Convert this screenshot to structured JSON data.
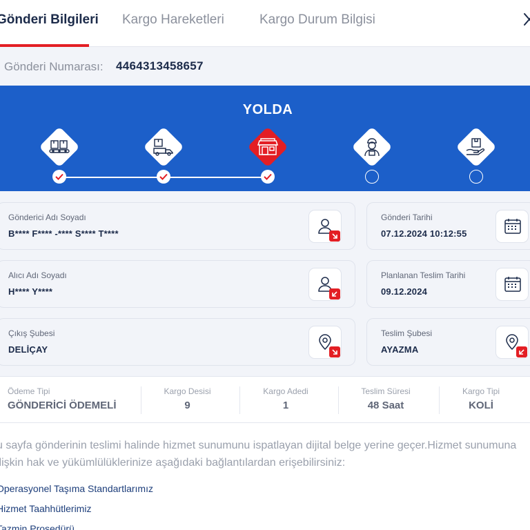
{
  "tabs": [
    {
      "label": "Gönderi Bilgileri",
      "active": true
    },
    {
      "label": "Kargo Hareketleri",
      "active": false
    },
    {
      "label": "Kargo Durum Bilgisi",
      "active": false
    }
  ],
  "shipment": {
    "label": "Gönderi Numarası:",
    "number": "4464313458657"
  },
  "status": {
    "title": "YOLDA",
    "current_step": 3,
    "steps": [
      {
        "icon": "boxes-conveyor-icon",
        "state": "done"
      },
      {
        "icon": "delivery-truck-icon",
        "state": "done"
      },
      {
        "icon": "branch-store-icon",
        "state": "done"
      },
      {
        "icon": "courier-icon",
        "state": "todo"
      },
      {
        "icon": "hand-package-icon",
        "state": "todo"
      }
    ]
  },
  "cards": {
    "sender": {
      "label": "Gönderici Adı Soyadı",
      "value": "B**** F**** -**** S**** T****",
      "icon": "person-icon"
    },
    "ship_date": {
      "label": "Gönderi Tarihi",
      "value": "07.12.2024 10:12:55",
      "icon": "calendar-icon"
    },
    "receiver": {
      "label": "Alıcı Adı Soyadı",
      "value": "H**** Y****",
      "icon": "person-icon"
    },
    "planned_date": {
      "label": "Planlanan Teslim Tarihi",
      "value": "09.12.2024",
      "icon": "calendar-icon"
    },
    "origin_branch": {
      "label": "Çıkış Şubesi",
      "value": "DELİÇAY",
      "icon": "location-pin-icon"
    },
    "delivery_branch": {
      "label": "Teslim Şubesi",
      "value": "AYAZMA",
      "icon": "location-pin-icon"
    }
  },
  "stats": [
    {
      "label": "Ödeme Tipi",
      "value": "GÖNDERİCİ ÖDEMELİ"
    },
    {
      "label": "Kargo Desisi",
      "value": "9"
    },
    {
      "label": "Kargo Adedi",
      "value": "1"
    },
    {
      "label": "Teslim Süresi",
      "value": "48 Saat"
    },
    {
      "label": "Kargo Tipi",
      "value": "KOLİ"
    }
  ],
  "description": "u sayfa gönderinin teslimi halinde hizmet sunumunu ispatlayan dijital belge yerine geçer.Hizmet sunumuna ilişkin hak ve yükümlülüklerinize aşağıdaki bağlantılardan erişebilirsiniz:",
  "links": [
    "Operasyonel Taşıma Standartlarımız",
    "Hizmet Taahhütlerimiz",
    "Tazmin Prosedürü"
  ],
  "colors": {
    "brand_red": "#e31e24",
    "brand_blue": "#1c5fc9",
    "navy": "#1c2b4a"
  }
}
